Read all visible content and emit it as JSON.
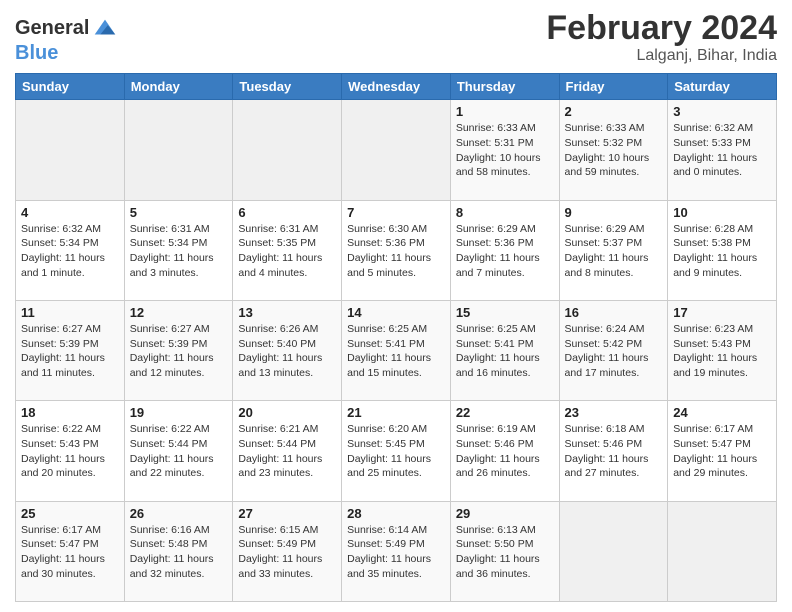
{
  "logo": {
    "line1": "General",
    "line2": "Blue"
  },
  "header": {
    "title": "February 2024",
    "subtitle": "Lalganj, Bihar, India"
  },
  "weekdays": [
    "Sunday",
    "Monday",
    "Tuesday",
    "Wednesday",
    "Thursday",
    "Friday",
    "Saturday"
  ],
  "weeks": [
    [
      {
        "day": "",
        "info": ""
      },
      {
        "day": "",
        "info": ""
      },
      {
        "day": "",
        "info": ""
      },
      {
        "day": "",
        "info": ""
      },
      {
        "day": "1",
        "info": "Sunrise: 6:33 AM\nSunset: 5:31 PM\nDaylight: 10 hours and 58 minutes."
      },
      {
        "day": "2",
        "info": "Sunrise: 6:33 AM\nSunset: 5:32 PM\nDaylight: 10 hours and 59 minutes."
      },
      {
        "day": "3",
        "info": "Sunrise: 6:32 AM\nSunset: 5:33 PM\nDaylight: 11 hours and 0 minutes."
      }
    ],
    [
      {
        "day": "4",
        "info": "Sunrise: 6:32 AM\nSunset: 5:34 PM\nDaylight: 11 hours and 1 minute."
      },
      {
        "day": "5",
        "info": "Sunrise: 6:31 AM\nSunset: 5:34 PM\nDaylight: 11 hours and 3 minutes."
      },
      {
        "day": "6",
        "info": "Sunrise: 6:31 AM\nSunset: 5:35 PM\nDaylight: 11 hours and 4 minutes."
      },
      {
        "day": "7",
        "info": "Sunrise: 6:30 AM\nSunset: 5:36 PM\nDaylight: 11 hours and 5 minutes."
      },
      {
        "day": "8",
        "info": "Sunrise: 6:29 AM\nSunset: 5:36 PM\nDaylight: 11 hours and 7 minutes."
      },
      {
        "day": "9",
        "info": "Sunrise: 6:29 AM\nSunset: 5:37 PM\nDaylight: 11 hours and 8 minutes."
      },
      {
        "day": "10",
        "info": "Sunrise: 6:28 AM\nSunset: 5:38 PM\nDaylight: 11 hours and 9 minutes."
      }
    ],
    [
      {
        "day": "11",
        "info": "Sunrise: 6:27 AM\nSunset: 5:39 PM\nDaylight: 11 hours and 11 minutes."
      },
      {
        "day": "12",
        "info": "Sunrise: 6:27 AM\nSunset: 5:39 PM\nDaylight: 11 hours and 12 minutes."
      },
      {
        "day": "13",
        "info": "Sunrise: 6:26 AM\nSunset: 5:40 PM\nDaylight: 11 hours and 13 minutes."
      },
      {
        "day": "14",
        "info": "Sunrise: 6:25 AM\nSunset: 5:41 PM\nDaylight: 11 hours and 15 minutes."
      },
      {
        "day": "15",
        "info": "Sunrise: 6:25 AM\nSunset: 5:41 PM\nDaylight: 11 hours and 16 minutes."
      },
      {
        "day": "16",
        "info": "Sunrise: 6:24 AM\nSunset: 5:42 PM\nDaylight: 11 hours and 17 minutes."
      },
      {
        "day": "17",
        "info": "Sunrise: 6:23 AM\nSunset: 5:43 PM\nDaylight: 11 hours and 19 minutes."
      }
    ],
    [
      {
        "day": "18",
        "info": "Sunrise: 6:22 AM\nSunset: 5:43 PM\nDaylight: 11 hours and 20 minutes."
      },
      {
        "day": "19",
        "info": "Sunrise: 6:22 AM\nSunset: 5:44 PM\nDaylight: 11 hours and 22 minutes."
      },
      {
        "day": "20",
        "info": "Sunrise: 6:21 AM\nSunset: 5:44 PM\nDaylight: 11 hours and 23 minutes."
      },
      {
        "day": "21",
        "info": "Sunrise: 6:20 AM\nSunset: 5:45 PM\nDaylight: 11 hours and 25 minutes."
      },
      {
        "day": "22",
        "info": "Sunrise: 6:19 AM\nSunset: 5:46 PM\nDaylight: 11 hours and 26 minutes."
      },
      {
        "day": "23",
        "info": "Sunrise: 6:18 AM\nSunset: 5:46 PM\nDaylight: 11 hours and 27 minutes."
      },
      {
        "day": "24",
        "info": "Sunrise: 6:17 AM\nSunset: 5:47 PM\nDaylight: 11 hours and 29 minutes."
      }
    ],
    [
      {
        "day": "25",
        "info": "Sunrise: 6:17 AM\nSunset: 5:47 PM\nDaylight: 11 hours and 30 minutes."
      },
      {
        "day": "26",
        "info": "Sunrise: 6:16 AM\nSunset: 5:48 PM\nDaylight: 11 hours and 32 minutes."
      },
      {
        "day": "27",
        "info": "Sunrise: 6:15 AM\nSunset: 5:49 PM\nDaylight: 11 hours and 33 minutes."
      },
      {
        "day": "28",
        "info": "Sunrise: 6:14 AM\nSunset: 5:49 PM\nDaylight: 11 hours and 35 minutes."
      },
      {
        "day": "29",
        "info": "Sunrise: 6:13 AM\nSunset: 5:50 PM\nDaylight: 11 hours and 36 minutes."
      },
      {
        "day": "",
        "info": ""
      },
      {
        "day": "",
        "info": ""
      }
    ]
  ]
}
